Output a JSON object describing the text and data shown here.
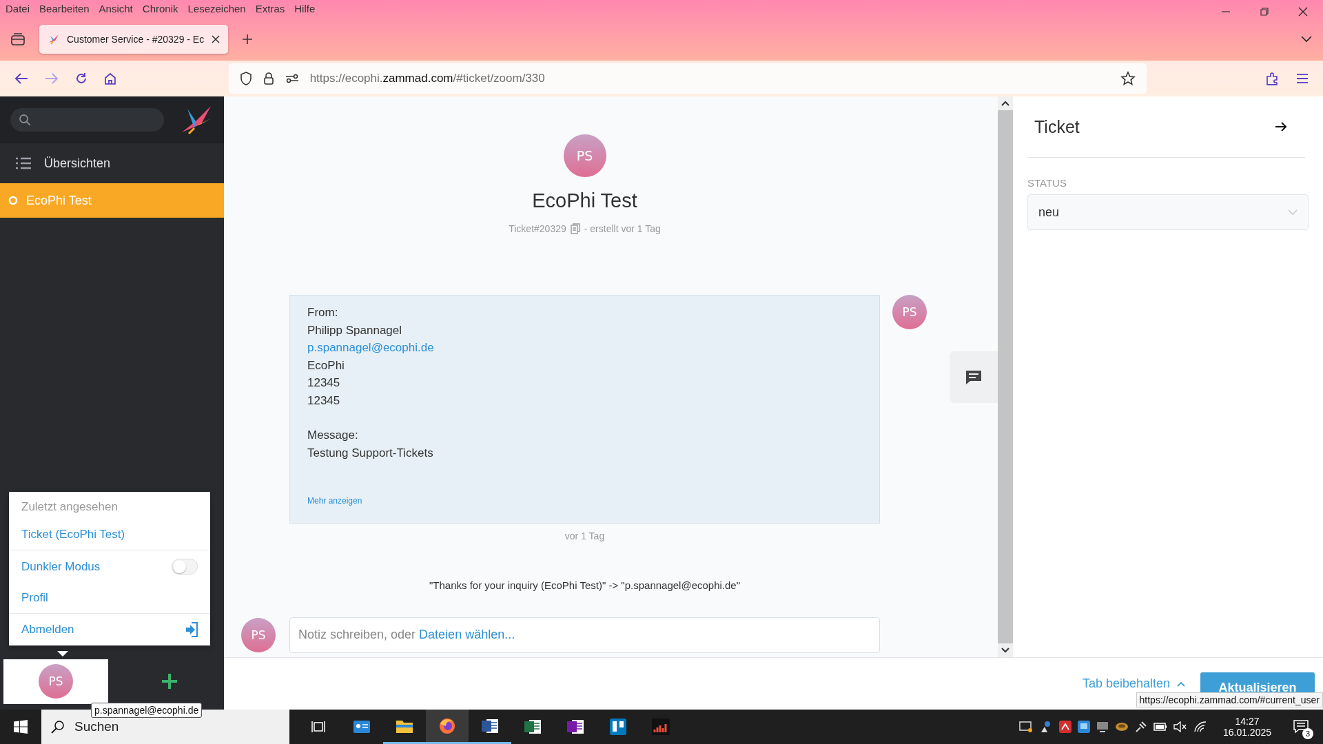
{
  "browser": {
    "menu": [
      "Datei",
      "Bearbeiten",
      "Ansicht",
      "Chronik",
      "Lesezeichen",
      "Extras",
      "Hilfe"
    ],
    "tab": {
      "title": "Customer Service - #20329 - Ec"
    },
    "url": {
      "prefix": "https://ecophi.",
      "host": "zammad.com",
      "path": "/#ticket/zoom/330"
    }
  },
  "sidebar": {
    "nav": [
      {
        "label": "Übersichten",
        "selected": false
      },
      {
        "label": "EcoPhi Test",
        "selected": true
      }
    ],
    "avatar": "PS"
  },
  "user_menu": {
    "heading": "Zuletzt angesehen",
    "items": [
      {
        "kind": "link",
        "label": "Ticket (EcoPhi Test)"
      },
      {
        "kind": "toggle",
        "label": "Dunkler Modus",
        "on": false
      },
      {
        "kind": "link",
        "label": "Profil"
      },
      {
        "kind": "logout",
        "label": "Abmelden"
      }
    ]
  },
  "user_tooltip": "p.spannagel@ecophi.de",
  "ticket": {
    "avatar": "PS",
    "title": "EcoPhi Test",
    "number": "Ticket#20329",
    "created": "- erstellt vor 1 Tag",
    "article": {
      "avatar": "PS",
      "blocks": [
        [
          {
            "kind": "text",
            "text": "From:"
          },
          {
            "kind": "text",
            "text": "Philipp Spannagel"
          },
          {
            "kind": "link",
            "text": "p.spannagel@ecophi.de"
          },
          {
            "kind": "text",
            "text": "EcoPhi"
          },
          {
            "kind": "text",
            "text": "12345"
          },
          {
            "kind": "text",
            "text": "12345"
          }
        ],
        [
          {
            "kind": "text",
            "text": "Message:"
          },
          {
            "kind": "text",
            "text": "Testung Support-Tickets"
          }
        ]
      ],
      "more": "Mehr anzeigen",
      "time": "vor 1 Tag"
    },
    "auto_reply": "\"Thanks for your inquiry (EcoPhi Test)\" -> \"p.spannagel@ecophi.de\"",
    "note": {
      "avatar": "PS",
      "prompt": "Notiz schreiben, oder",
      "link": "Dateien wählen..."
    }
  },
  "panel": {
    "title": "Ticket",
    "fields": [
      {
        "label": "STATUS",
        "value": "neu"
      }
    ]
  },
  "footer": {
    "keep_tab": "Tab beibehalten",
    "update": "Aktualisieren"
  },
  "status_url": "https://ecophi.zammad.com/#current_user",
  "taskbar": {
    "search": "Suchen",
    "apps": [
      {
        "kind": "taskview",
        "running": false,
        "selected": false
      },
      {
        "kind": "contacts",
        "running": false,
        "selected": false
      },
      {
        "kind": "explorer",
        "running": true,
        "selected": false
      },
      {
        "kind": "firefox",
        "running": true,
        "selected": true
      },
      {
        "kind": "word",
        "running": true,
        "selected": false
      },
      {
        "kind": "excel",
        "running": false,
        "selected": false
      },
      {
        "kind": "onenote",
        "running": false,
        "selected": false
      },
      {
        "kind": "trello",
        "running": false,
        "selected": false
      },
      {
        "kind": "equalizer",
        "running": false,
        "selected": false
      }
    ],
    "time": "14:27",
    "date": "16.01.2025",
    "notifications": "3"
  }
}
